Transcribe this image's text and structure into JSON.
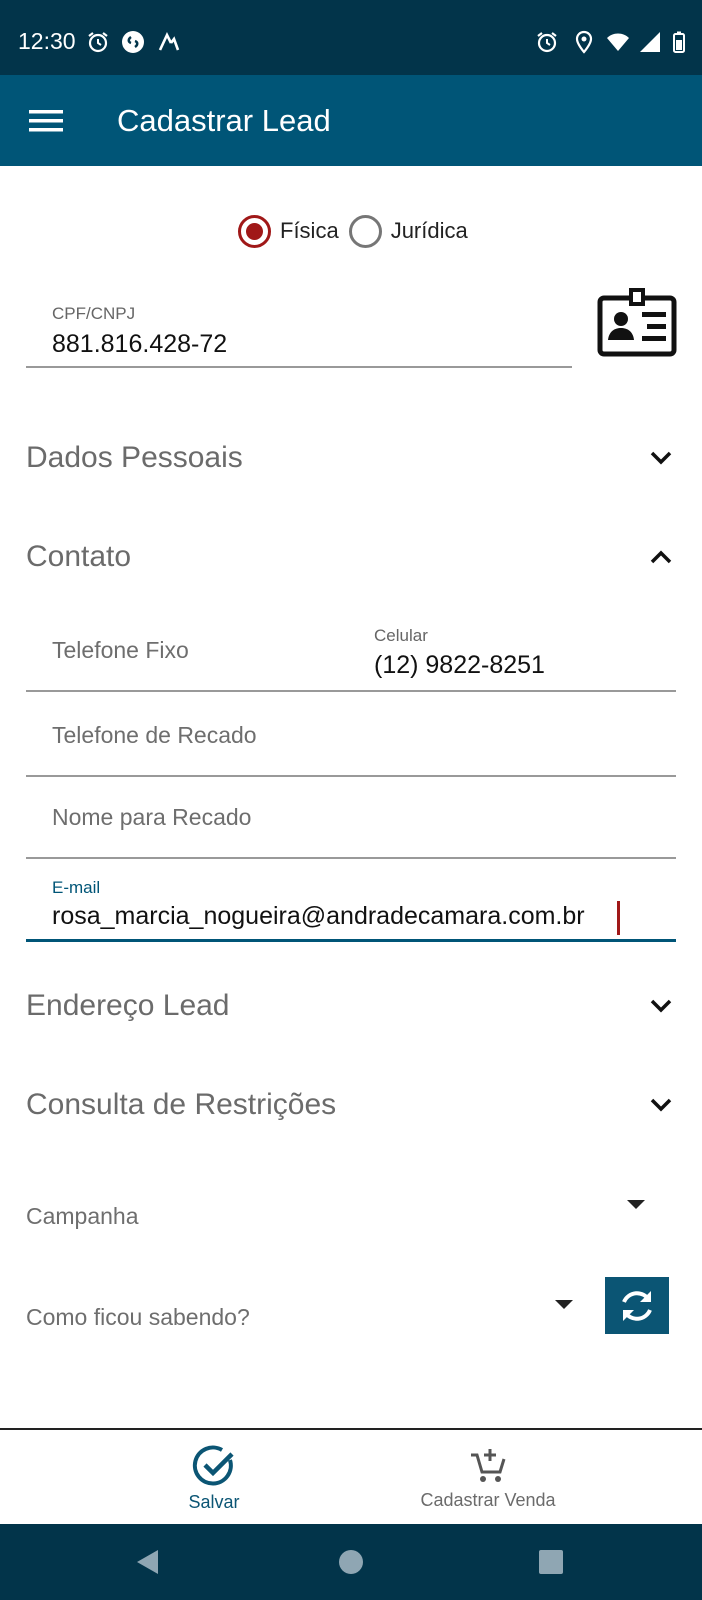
{
  "status_bar": {
    "time": "12:30",
    "left_icons": [
      "alarm-icon",
      "shazam-icon",
      "app-a-icon"
    ],
    "right_icons": [
      "alarm-icon",
      "location-icon",
      "wifi-icon",
      "signal-icon",
      "battery-icon"
    ]
  },
  "app_bar": {
    "title": "Cadastrar Lead",
    "menu_icon": "hamburger-menu-icon"
  },
  "person_type": {
    "options": [
      {
        "label": "Física",
        "checked": true
      },
      {
        "label": "Jurídica",
        "checked": false
      }
    ]
  },
  "document": {
    "label": "CPF/CNPJ",
    "value": "881.816.428-72",
    "scan_icon": "id-card-icon"
  },
  "sections": {
    "dados_pessoais": {
      "title": "Dados Pessoais",
      "expanded": false
    },
    "contato": {
      "title": "Contato",
      "expanded": true
    },
    "endereco": {
      "title": "Endereço Lead",
      "expanded": false
    },
    "restricoes": {
      "title": "Consulta de Restrições",
      "expanded": false
    }
  },
  "contato": {
    "telefone_fixo": {
      "placeholder": "Telefone Fixo",
      "value": ""
    },
    "celular": {
      "label": "Celular",
      "value": "(12) 9822-8251"
    },
    "telefone_recado": {
      "placeholder": "Telefone de Recado",
      "value": ""
    },
    "nome_recado": {
      "placeholder": "Nome para Recado",
      "value": ""
    },
    "email": {
      "label": "E-mail",
      "value": "rosa_marcia_nogueira@andradecamara.com.br"
    }
  },
  "campanha": {
    "placeholder": "Campanha"
  },
  "como_ficou_sabendo": {
    "placeholder": "Como ficou sabendo?"
  },
  "bottom_nav": {
    "salvar": {
      "label": "Salvar",
      "icon": "check-circle-icon"
    },
    "cadastrar_venda": {
      "label": "Cadastrar Venda",
      "icon": "cart-add-icon"
    }
  },
  "colors": {
    "status_bar": "#02344a",
    "app_bar": "#005577",
    "radio_checked": "#a01818",
    "accent": "#0b5574"
  }
}
